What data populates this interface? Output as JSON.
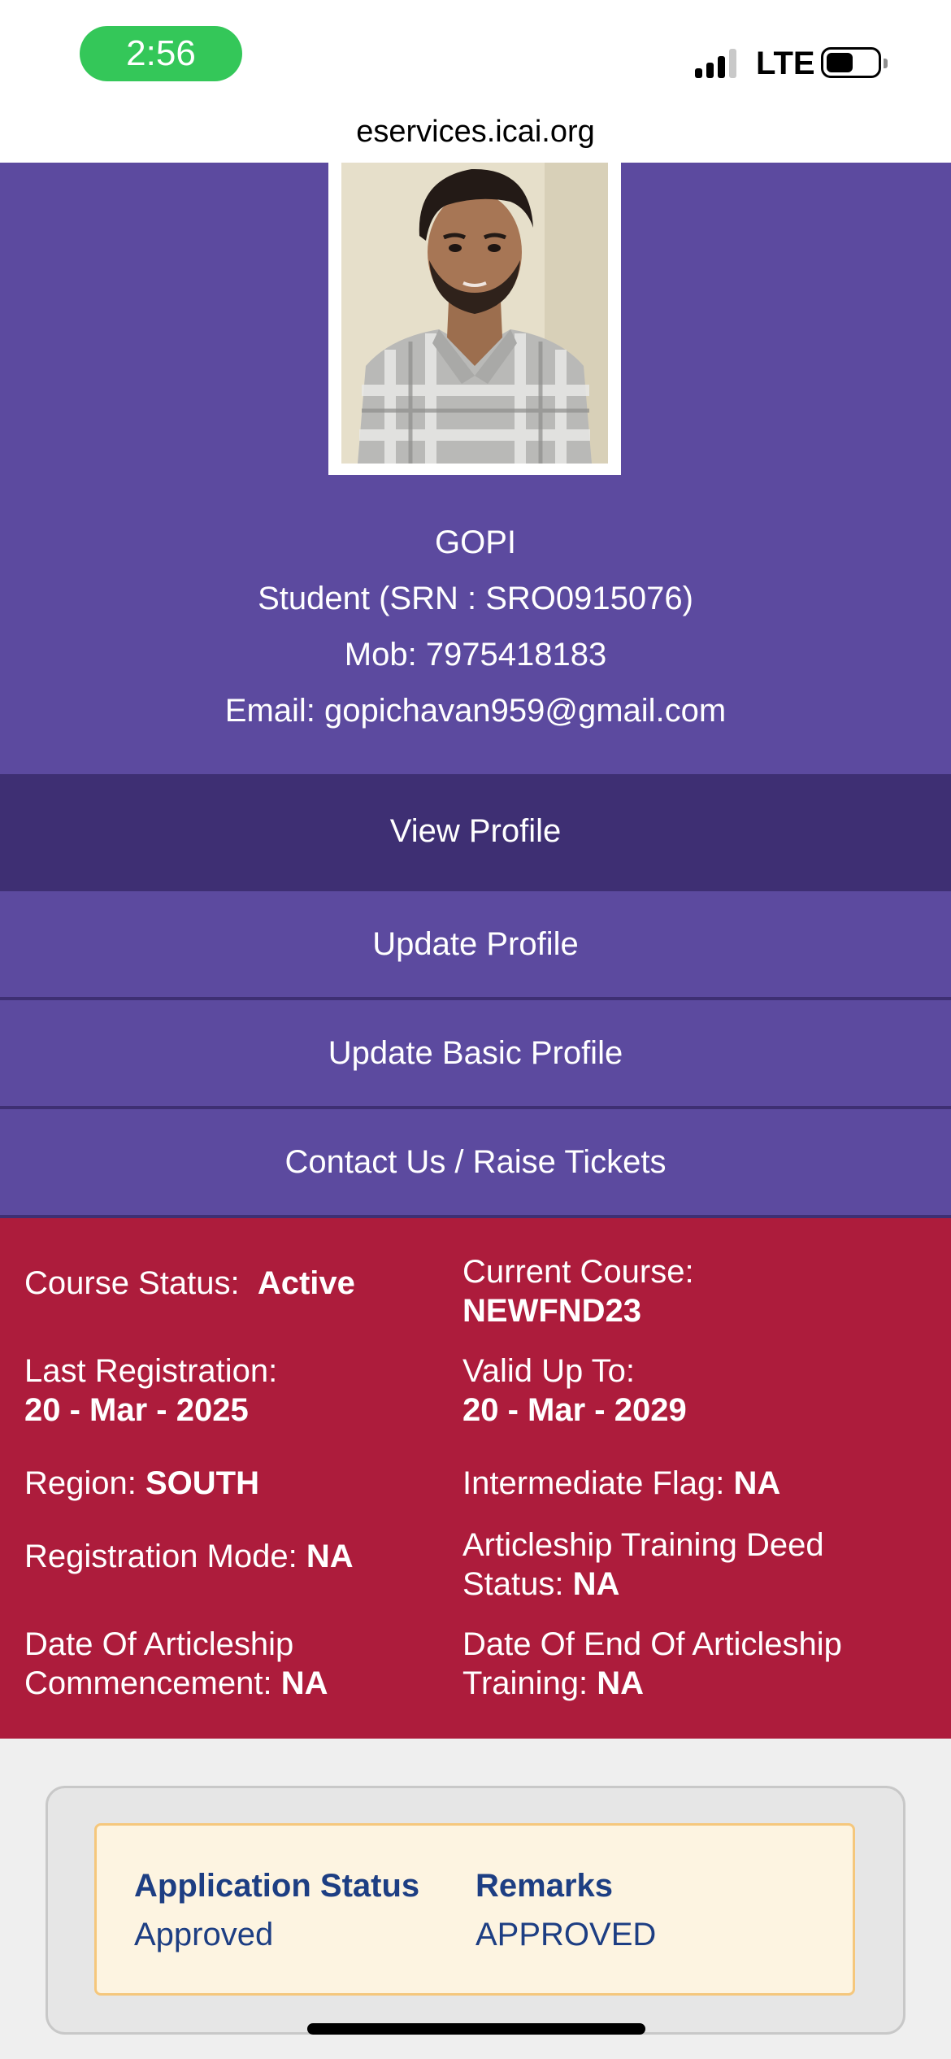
{
  "status_bar": {
    "time": "2:56",
    "network": "LTE",
    "url": "eservices.icai.org"
  },
  "profile": {
    "name": "GOPI",
    "role_line": "Student (SRN : SRO0915076)",
    "mobile_line": "Mob: 7975418183",
    "email_line": "Email: gopichavan959@gmail.com"
  },
  "menu": {
    "items": [
      {
        "label": "View Profile",
        "active": true
      },
      {
        "label": "Update Profile"
      },
      {
        "label": "Update Basic Profile"
      },
      {
        "label": "Contact Us / Raise Tickets"
      }
    ]
  },
  "details": {
    "course_status": {
      "label": "Course Status:",
      "value": "Active"
    },
    "current_course": {
      "label": "Current Course:",
      "value": "NEWFND23"
    },
    "last_registration": {
      "label": "Last Registration:",
      "value": "20 - Mar - 2025"
    },
    "valid_up_to": {
      "label": "Valid Up To:",
      "value": "20 - Mar - 2029"
    },
    "region": {
      "label": "Region:",
      "value": "SOUTH"
    },
    "intermediate_flag": {
      "label": "Intermediate Flag:",
      "value": "NA"
    },
    "registration_mode": {
      "label": "Registration Mode:",
      "value": "NA"
    },
    "articleship_deed": {
      "label_line1": "Articleship Training Deed",
      "label_line2": "Status:",
      "value": "NA"
    },
    "articleship_commencement": {
      "label_line1": "Date Of Articleship",
      "label_line2": "Commencement:",
      "value": "NA"
    },
    "articleship_end": {
      "label_line1": "Date Of End Of Articleship",
      "label_line2": "Training:",
      "value": "NA"
    }
  },
  "application": {
    "status_header": "Application Status",
    "status_value": "Approved",
    "remarks_header": "Remarks",
    "remarks_value": "APPROVED"
  },
  "colors": {
    "purple": "#5c4a9f",
    "purple_dark": "#3e2f73",
    "crimson": "#ad1c3c",
    "card_text": "#1d3e83",
    "time_pill": "#34c759"
  }
}
